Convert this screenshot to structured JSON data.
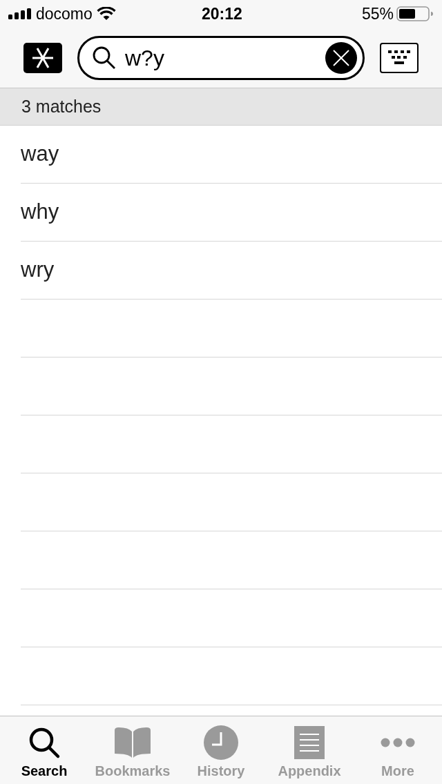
{
  "status_bar": {
    "carrier": "docomo",
    "time": "20:12",
    "battery": "55%"
  },
  "search": {
    "value": "w?y"
  },
  "result_count": "3 matches",
  "results": [
    {
      "word": "way"
    },
    {
      "word": "why"
    },
    {
      "word": "wry"
    }
  ],
  "tabs": [
    {
      "label": "Search",
      "kind": "search",
      "selected": true
    },
    {
      "label": "Bookmarks",
      "kind": "bookmarks",
      "selected": false
    },
    {
      "label": "History",
      "kind": "history",
      "selected": false
    },
    {
      "label": "Appendix",
      "kind": "appendix",
      "selected": false
    },
    {
      "label": "More",
      "kind": "more",
      "selected": false
    }
  ]
}
